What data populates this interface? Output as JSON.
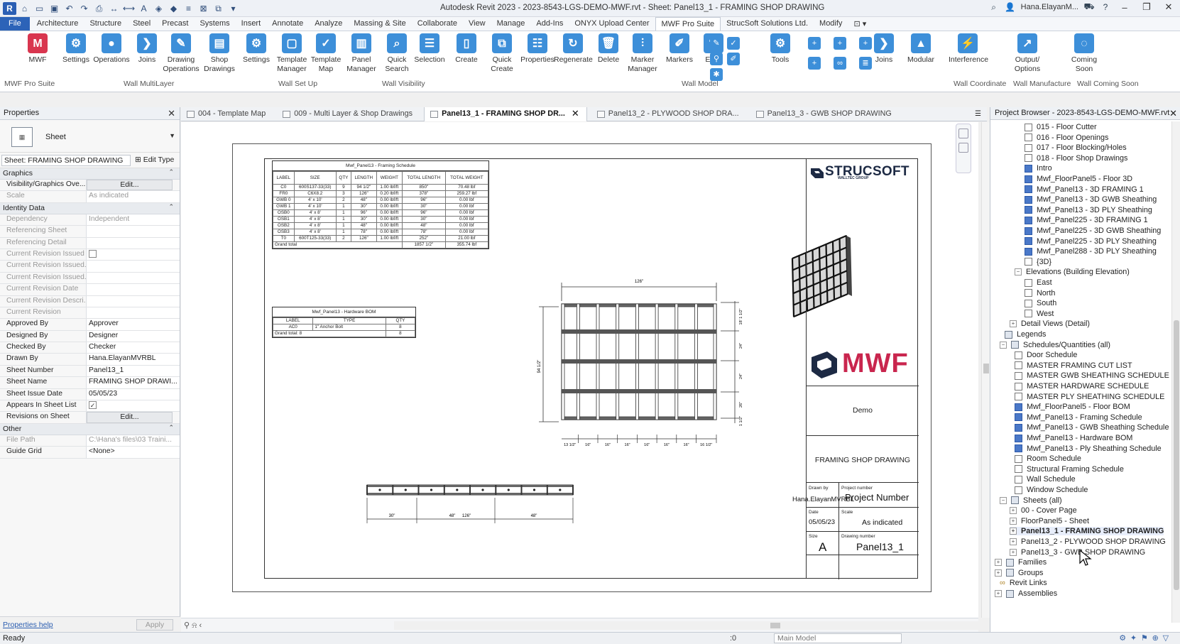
{
  "app": {
    "title": "Autodesk Revit 2023 - 2023-8543-LGS-DEMO-MWF.rvt - Sheet: Panel13_1 - FRAMING SHOP DRAWING",
    "user": "Hana.ElayanM...",
    "file_tab": "File"
  },
  "menu_tabs": [
    "Architecture",
    "Structure",
    "Steel",
    "Precast",
    "Systems",
    "Insert",
    "Annotate",
    "Analyze",
    "Massing & Site",
    "Collaborate",
    "View",
    "Manage",
    "Add-Ins",
    "ONYX Upload Center",
    "MWF Pro Suite",
    "StrucSoft Solutions Ltd.",
    "Modify"
  ],
  "active_menu": "MWF Pro Suite",
  "ribbon": {
    "buttons": [
      {
        "label": "MWF",
        "color": "#d9364f"
      },
      {
        "label": "Settings",
        "color": "#3d8fd9"
      },
      {
        "label": "Operations",
        "color": "#3d8fd9"
      },
      {
        "label": "Joins",
        "color": "#3d8fd9"
      },
      {
        "label": "Drawing\nOperations",
        "color": "#3d8fd9"
      },
      {
        "label": "Shop\nDrawings",
        "color": "#3d8fd9"
      },
      {
        "label": "Settings",
        "color": "#3d8fd9"
      },
      {
        "label": "Template\nManager",
        "color": "#3d8fd9"
      },
      {
        "label": "Template\nMap",
        "color": "#3d8fd9"
      },
      {
        "label": "Panel\nManager",
        "color": "#3d8fd9"
      },
      {
        "label": "Quick\nSearch",
        "color": "#3d8fd9"
      },
      {
        "label": "Selection",
        "color": "#3d8fd9"
      },
      {
        "label": "Create",
        "color": "#3d8fd9"
      },
      {
        "label": "Quick\nCreate",
        "color": "#3d8fd9"
      },
      {
        "label": "Properties",
        "color": "#3d8fd9"
      },
      {
        "label": "Regenerate",
        "color": "#3d8fd9"
      },
      {
        "label": "Delete",
        "color": "#3d8fd9"
      },
      {
        "label": "Marker\nManager",
        "color": "#3d8fd9"
      },
      {
        "label": "Markers",
        "color": "#3d8fd9"
      },
      {
        "label": "Edits",
        "color": "#3d8fd9"
      },
      {
        "label": "Tools",
        "color": "#3d8fd9"
      },
      {
        "label": "Joins",
        "color": "#3d8fd9"
      },
      {
        "label": "Modular",
        "color": "#3d8fd9"
      },
      {
        "label": "Interference",
        "color": "#3d8fd9"
      },
      {
        "label": "Output/\nOptions",
        "color": "#3d8fd9"
      },
      {
        "label": "Coming\nSoon",
        "color": "#3d8fd9"
      }
    ],
    "panels": [
      "MWF Pro Suite",
      "Wall MultiLayer",
      "Wall Set Up",
      "Wall Visibility",
      "Wall Model",
      "Wall Coordinate",
      "Wall Manufacture",
      "Wall Coming Soon"
    ]
  },
  "properties": {
    "title": "Properties",
    "type_name": "Sheet",
    "instance_filter": "Sheet: FRAMING SHOP DRAWING",
    "edit_type": "Edit Type",
    "groups": [
      {
        "name": "Graphics",
        "rows": [
          {
            "name": "Visibility/Graphics Ove...",
            "value": "Edit...",
            "kind": "btn"
          },
          {
            "name": "Scale",
            "value": "As indicated",
            "kind": "dim"
          }
        ]
      },
      {
        "name": "Identity Data",
        "rows": [
          {
            "name": "Dependency",
            "value": "Independent",
            "kind": "dim"
          },
          {
            "name": "Referencing Sheet",
            "value": "",
            "kind": "dim"
          },
          {
            "name": "Referencing Detail",
            "value": "",
            "kind": "dim"
          },
          {
            "name": "Current Revision Issued",
            "value": "",
            "kind": "dimcb"
          },
          {
            "name": "Current Revision Issued...",
            "value": "",
            "kind": "dim"
          },
          {
            "name": "Current Revision Issued...",
            "value": "",
            "kind": "dim"
          },
          {
            "name": "Current Revision Date",
            "value": "",
            "kind": "dim"
          },
          {
            "name": "Current Revision Descri...",
            "value": "",
            "kind": "dim"
          },
          {
            "name": "Current Revision",
            "value": "",
            "kind": "dim"
          },
          {
            "name": "Approved By",
            "value": "Approver",
            "kind": ""
          },
          {
            "name": "Designed By",
            "value": "Designer",
            "kind": ""
          },
          {
            "name": "Checked By",
            "value": "Checker",
            "kind": ""
          },
          {
            "name": "Drawn By",
            "value": "Hana.ElayanMVRBL",
            "kind": ""
          },
          {
            "name": "Sheet Number",
            "value": "Panel13_1",
            "kind": ""
          },
          {
            "name": "Sheet Name",
            "value": "FRAMING SHOP DRAWI...",
            "kind": ""
          },
          {
            "name": "Sheet Issue Date",
            "value": "05/05/23",
            "kind": ""
          },
          {
            "name": "Appears In Sheet List",
            "value": "✓",
            "kind": "cb"
          },
          {
            "name": "Revisions on Sheet",
            "value": "Edit...",
            "kind": "btn"
          }
        ]
      },
      {
        "name": "Other",
        "rows": [
          {
            "name": "File Path",
            "value": "C:\\Hana's files\\03 Traini...",
            "kind": "dim"
          },
          {
            "name": "Guide Grid",
            "value": "<None>",
            "kind": ""
          }
        ]
      }
    ],
    "help": "Properties help",
    "apply": "Apply"
  },
  "view_tabs": [
    {
      "label": "004 - Template Map",
      "active": false
    },
    {
      "label": "009 - Multi Layer & Shop Drawings",
      "active": false
    },
    {
      "label": "Panel13_1 - FRAMING SHOP DR...",
      "active": true
    },
    {
      "label": "Panel13_2 - PLYWOOD SHOP DRA...",
      "active": false
    },
    {
      "label": "Panel13_3 - GWB SHOP DRAWING",
      "active": false
    }
  ],
  "framing_schedule": {
    "title": "Mwf_Panel13 - Framing Schedule",
    "headers": [
      "LABEL",
      "SIZE",
      "QTY",
      "LENGTH",
      "WEIGHT",
      "TOTAL LENGTH",
      "TOTAL WEIGHT"
    ],
    "rows": [
      [
        "C0",
        "600S137-33(33)",
        "9",
        "94 1/2\"",
        "1.00 lbf/ft",
        "850\"",
        "70.48 lbf"
      ],
      [
        "FR0",
        "C6X8.2",
        "3",
        "126\"",
        "0.20 lbf/ft",
        "378\"",
        "259.27 lbf"
      ],
      [
        "GWB 0",
        "4' x 10'",
        "2",
        "48\"",
        "0.00 lbf/ft",
        "96\"",
        "0.00 lbf"
      ],
      [
        "GWB 1",
        "4' x 10'",
        "1",
        "30\"",
        "0.00 lbf/ft",
        "30\"",
        "0.00 lbf"
      ],
      [
        "OSB0",
        "4' x 8'",
        "1",
        "96\"",
        "0.00 lbf/ft",
        "96\"",
        "0.00 lbf"
      ],
      [
        "OSB1",
        "4' x 8'",
        "1",
        "30\"",
        "0.00 lbf/ft",
        "30\"",
        "0.00 lbf"
      ],
      [
        "OSB2",
        "4' x 8'",
        "1",
        "48\"",
        "0.00 lbf/ft",
        "48\"",
        "0.00 lbf"
      ],
      [
        "OSB3",
        "4' x 8'",
        "1",
        "78\"",
        "0.00 lbf/ft",
        "78\"",
        "0.00 lbf"
      ],
      [
        "T0",
        "600T125-33(33)",
        "2",
        "126\"",
        "1.00 lbf/ft",
        "252\"",
        "21.00 lbf"
      ]
    ],
    "total_label": "Grand total",
    "total_length": "1857 1/2\"",
    "total_weight": "355.74 lbf"
  },
  "hardware_bom": {
    "title": "Mwf_Panel13 - Hardware BOM",
    "headers": [
      "LABEL",
      "TYPE",
      "QTY"
    ],
    "rows": [
      [
        "AC0",
        "1\" Anchor Bolt",
        "8"
      ]
    ],
    "total": "Grand total: 8",
    "total_qty": "8"
  },
  "elevation_dims": {
    "width": "126\"",
    "height": "94 1/2\"",
    "right": [
      "18' 1 1/2\"",
      "24\"",
      "24\"",
      "26\"",
      "1 1/2\""
    ],
    "bottom": [
      "13 1/2\"",
      "16\"",
      "16\"",
      "16\"",
      "16\"",
      "16\"",
      "16\"",
      "16 1/2\""
    ],
    "plan": [
      "30\"",
      "48\"",
      "126\"",
      "48\""
    ]
  },
  "titleblock": {
    "company": "STRUCSOFT",
    "company_sub": "WALLTEC GROUP",
    "brand": "MWF",
    "client": "Demo",
    "sheet_title": "FRAMING SHOP DRAWING",
    "drawn_by_label": "Drawn by",
    "drawn_by": "Hana.ElayanMVRBL",
    "project_number_label": "Project number",
    "project_number": "Project Number",
    "date_label": "Date",
    "date": "05/05/23",
    "scale_label": "Scale",
    "scale": "As indicated",
    "size_label": "Size",
    "size": "A",
    "drawing_number_label": "Drawing number",
    "drawing_number": "Panel13_1"
  },
  "project_browser": {
    "title": "Project Browser - 2023-8543-LGS-DEMO-MWF.rvt",
    "items": [
      {
        "label": "015 - Floor Cutter",
        "indent": 3,
        "icon": "view"
      },
      {
        "label": "016 - Floor Openings",
        "indent": 3,
        "icon": "view"
      },
      {
        "label": "017 - Floor Blocking/Holes",
        "indent": 3,
        "icon": "view"
      },
      {
        "label": "018 - Floor Shop Drawings",
        "indent": 3,
        "icon": "view"
      },
      {
        "label": "Intro",
        "indent": 3,
        "icon": "sel"
      },
      {
        "label": "Mwf_FloorPanel5 - Floor 3D",
        "indent": 3,
        "icon": "sel"
      },
      {
        "label": "Mwf_Panel13 - 3D FRAMING 1",
        "indent": 3,
        "icon": "sel"
      },
      {
        "label": "Mwf_Panel13 - 3D GWB Sheathing",
        "indent": 3,
        "icon": "sel"
      },
      {
        "label": "Mwf_Panel13 - 3D PLY Sheathing",
        "indent": 3,
        "icon": "sel"
      },
      {
        "label": "Mwf_Panel225 - 3D FRAMING 1",
        "indent": 3,
        "icon": "sel"
      },
      {
        "label": "Mwf_Panel225 - 3D GWB Sheathing",
        "indent": 3,
        "icon": "sel"
      },
      {
        "label": "Mwf_Panel225 - 3D PLY Sheathing",
        "indent": 3,
        "icon": "sel"
      },
      {
        "label": "Mwf_Panel288 - 3D PLY Sheathing",
        "indent": 3,
        "icon": "sel"
      },
      {
        "label": "{3D}",
        "indent": 3,
        "icon": "view"
      },
      {
        "label": "Elevations (Building Elevation)",
        "indent": 2,
        "icon": "none",
        "ex": "−"
      },
      {
        "label": "East",
        "indent": 3,
        "icon": "view"
      },
      {
        "label": "North",
        "indent": 3,
        "icon": "view"
      },
      {
        "label": "South",
        "indent": 3,
        "icon": "view"
      },
      {
        "label": "West",
        "indent": 3,
        "icon": "view"
      },
      {
        "label": "Detail Views (Detail)",
        "indent": 1.5,
        "icon": "none",
        "ex": "+"
      },
      {
        "label": "Legends",
        "indent": 1,
        "icon": "grp",
        "ex": ""
      },
      {
        "label": "Schedules/Quantities (all)",
        "indent": 0.5,
        "icon": "grp",
        "ex": "−"
      },
      {
        "label": "Door Schedule",
        "indent": 2,
        "icon": "view"
      },
      {
        "label": "MASTER FRAMING CUT LIST",
        "indent": 2,
        "icon": "view"
      },
      {
        "label": "MASTER GWB SHEATHING SCHEDULE",
        "indent": 2,
        "icon": "view"
      },
      {
        "label": "MASTER HARDWARE SCHEDULE",
        "indent": 2,
        "icon": "view"
      },
      {
        "label": "MASTER PLY SHEATHING SCHEDULE",
        "indent": 2,
        "icon": "view"
      },
      {
        "label": "Mwf_FloorPanel5 - Floor BOM",
        "indent": 2,
        "icon": "sel"
      },
      {
        "label": "Mwf_Panel13 - Framing Schedule",
        "indent": 2,
        "icon": "sel"
      },
      {
        "label": "Mwf_Panel13 - GWB Sheathing Schedule",
        "indent": 2,
        "icon": "sel"
      },
      {
        "label": "Mwf_Panel13 - Hardware BOM",
        "indent": 2,
        "icon": "sel"
      },
      {
        "label": "Mwf_Panel13 - Ply Sheathing Schedule",
        "indent": 2,
        "icon": "sel"
      },
      {
        "label": "Room Schedule",
        "indent": 2,
        "icon": "view"
      },
      {
        "label": "Structural Framing Schedule",
        "indent": 2,
        "icon": "view"
      },
      {
        "label": "Wall Schedule",
        "indent": 2,
        "icon": "view"
      },
      {
        "label": "Window Schedule",
        "indent": 2,
        "icon": "view"
      },
      {
        "label": "Sheets (all)",
        "indent": 0.5,
        "icon": "grp",
        "ex": "−"
      },
      {
        "label": "00 - Cover Page",
        "indent": 1.5,
        "icon": "none",
        "ex": "+"
      },
      {
        "label": "FloorPanel5 - Sheet",
        "indent": 1.5,
        "icon": "none",
        "ex": "+"
      },
      {
        "label": "Panel13_1 - FRAMING SHOP DRAWING",
        "indent": 1.5,
        "icon": "none",
        "ex": "+",
        "bold": true
      },
      {
        "label": "Panel13_2 - PLYWOOD SHOP DRAWING",
        "indent": 1.5,
        "icon": "none",
        "ex": "+"
      },
      {
        "label": "Panel13_3 - GWB SHOP DRAWING",
        "indent": 1.5,
        "icon": "none",
        "ex": "+"
      },
      {
        "label": "Families",
        "indent": 0,
        "icon": "grp",
        "ex": "+"
      },
      {
        "label": "Groups",
        "indent": 0,
        "icon": "grp",
        "ex": "+"
      },
      {
        "label": "Revit Links",
        "indent": 0.5,
        "icon": "link",
        "ex": ""
      },
      {
        "label": "Assemblies",
        "indent": 0,
        "icon": "grp",
        "ex": "+"
      }
    ]
  },
  "status": {
    "text": "Ready",
    "zero": ":0",
    "model": "Main Model"
  }
}
